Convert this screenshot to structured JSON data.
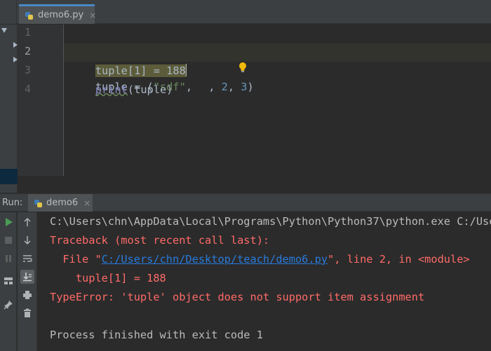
{
  "editor_tab": {
    "file_name": "demo6.py",
    "close": "×",
    "icon": "python-file-icon"
  },
  "editor": {
    "line_numbers": [
      "1",
      "2",
      "3",
      "4"
    ],
    "line1": {
      "name": "tuple",
      "assign": " = (",
      "s1": "\"sdf\"",
      "sep1": ", ",
      "sep2": ", ",
      "n2": "2",
      "sep3": ", ",
      "n3": "3",
      "close": ")"
    },
    "line2": {
      "text": "tuple[1] = 188"
    },
    "line3": {
      "fn": "print",
      "rest": "(tuple)"
    }
  },
  "run_panel": {
    "label": "Run:",
    "tab_label": "demo6",
    "tab_close": "×",
    "output": {
      "cmd": "C:\\Users\\chn\\AppData\\Local\\Programs\\Python\\Python37\\python.exe C:/Users/chn/Desktop/teach/demo6.py",
      "traceback": "Traceback (most recent call last):",
      "file_prefix": "  File \"",
      "file_link": "C:/Users/chn/Desktop/teach/demo6.py",
      "file_suffix": "\", line 2, in <module>",
      "code": "    tuple[1] = 188",
      "error": "TypeError: 'tuple' object does not support item assignment",
      "blank": "",
      "finished": "Process finished with exit code 1"
    }
  },
  "colors": {
    "background": "#2b2b2b",
    "panel": "#3c3f41",
    "error_red": "#ff6b68",
    "link_blue": "#287bde",
    "string_green": "#6a8759",
    "number_blue": "#6897bb",
    "builtin_purple": "#8888c6"
  }
}
